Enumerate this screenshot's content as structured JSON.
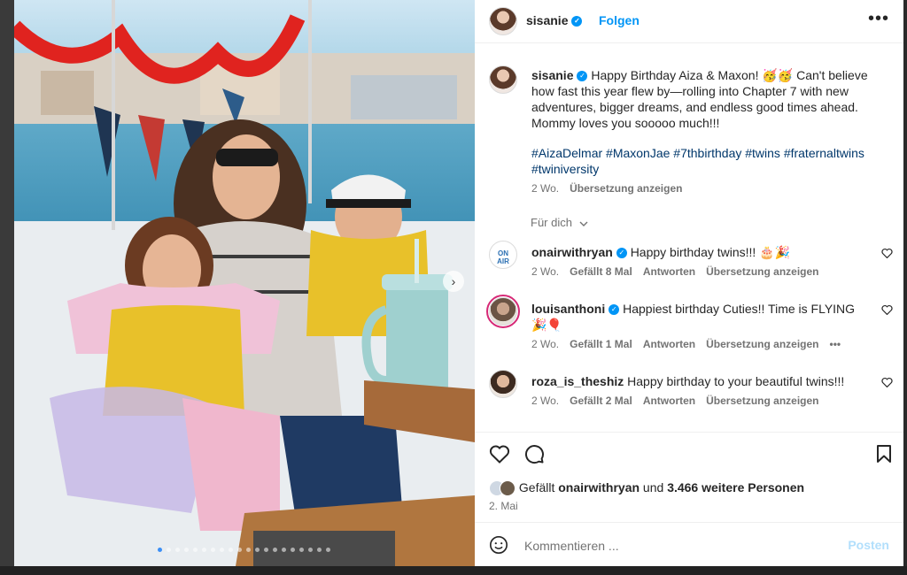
{
  "post": {
    "author": "sisanie",
    "follow_label": "Folgen",
    "more_icon": "•••"
  },
  "caption": {
    "username": "sisanie",
    "text": " Happy Birthday Aiza & Maxon! 🥳🥳 Can't believe how fast this year flew by—rolling into Chapter 7 with new adventures, bigger dreams, and endless good times ahead. Mommy loves you sooooo much!!!",
    "hashtags": "#AizaDelmar #MaxonJae #7thbirthday #twins #fraternaltwins #twiniversity",
    "age": "2 Wo.",
    "translate": "Übersetzung anzeigen"
  },
  "sort_label": "Für dich",
  "comments": [
    {
      "username": "onairwithryan",
      "verified": true,
      "text": "Happy birthday twins!!! 🎂🎉",
      "age": "2 Wo.",
      "likes": "Gefällt 8 Mal",
      "reply": "Antworten",
      "translate": "Übersetzung anzeigen"
    },
    {
      "username": "louisanthoni",
      "verified": true,
      "text": "Happiest birthday Cuties!! Time is FLYING 🎉🎈",
      "age": "2 Wo.",
      "likes": "Gefällt 1 Mal",
      "reply": "Antworten",
      "translate": "Übersetzung anzeigen",
      "more": "•••"
    },
    {
      "username": "roza_is_theshiz",
      "verified": false,
      "text": "Happy birthday to your beautiful twins!!!",
      "age": "2 Wo.",
      "likes": "Gefällt 2 Mal",
      "reply": "Antworten",
      "translate": "Übersetzung anzeigen"
    }
  ],
  "likes_bar": {
    "prefix": "Gefällt ",
    "user": "onairwithryan",
    "middle": " und ",
    "others": "3.466 weitere Personen",
    "date": "2. Mai"
  },
  "composer": {
    "placeholder": "Kommentieren ...",
    "post_label": "Posten"
  },
  "carousel": {
    "slide_count": 20,
    "active_index": 0
  },
  "colors": {
    "link": "#0095f6",
    "hashtag": "#00376b",
    "meta": "#737373"
  },
  "icons": [
    "verified-badge-icon",
    "more-options-icon",
    "heart-icon",
    "comment-icon",
    "bookmark-icon",
    "emoji-icon",
    "chevron-down-icon",
    "next-slide-icon"
  ]
}
